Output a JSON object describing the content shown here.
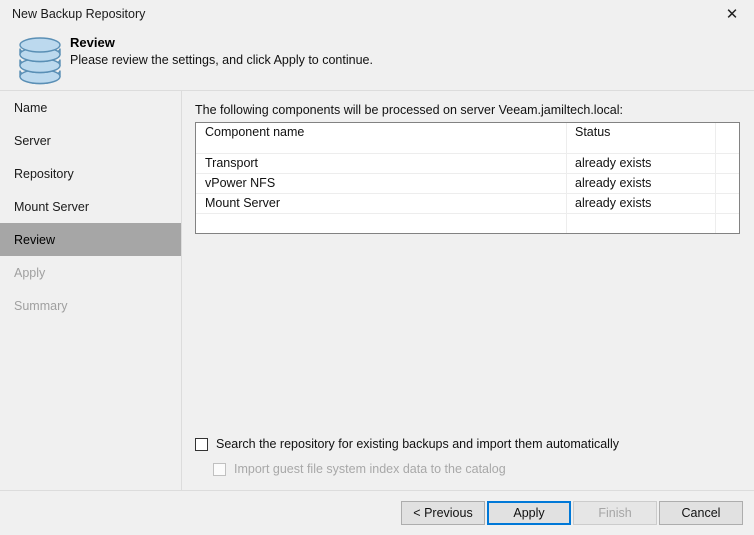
{
  "window": {
    "title": "New Backup Repository",
    "close_icon": "close-icon"
  },
  "header": {
    "icon": "database-repository-icon",
    "title": "Review",
    "subtitle": "Please review the settings, and click Apply to continue."
  },
  "sidebar": {
    "items": [
      {
        "label": "Name",
        "state": "normal"
      },
      {
        "label": "Server",
        "state": "normal"
      },
      {
        "label": "Repository",
        "state": "normal"
      },
      {
        "label": "Mount Server",
        "state": "normal"
      },
      {
        "label": "Review",
        "state": "selected"
      },
      {
        "label": "Apply",
        "state": "disabled"
      },
      {
        "label": "Summary",
        "state": "disabled"
      }
    ],
    "selected_index": 4,
    "highlight_color": "#a6a6a6"
  },
  "main": {
    "components_label": "The following components will be processed on server Veeam.jamiltech.local:",
    "table": {
      "columns": [
        "Component name",
        "Status",
        ""
      ],
      "rows": [
        {
          "component_name": "Transport",
          "status": "already exists"
        },
        {
          "component_name": "vPower NFS",
          "status": "already exists"
        },
        {
          "component_name": "Mount Server",
          "status": "already exists"
        }
      ]
    },
    "options": [
      {
        "label": "Search the repository for existing backups and import them automatically",
        "checked": false,
        "enabled": true
      },
      {
        "label": "Import guest file system index data to the catalog",
        "checked": false,
        "enabled": false
      }
    ]
  },
  "footer": {
    "buttons": [
      {
        "label": "< Previous",
        "state": "normal"
      },
      {
        "label": "Apply",
        "state": "focused"
      },
      {
        "label": "Finish",
        "state": "disabled"
      },
      {
        "label": "Cancel",
        "state": "normal"
      }
    ],
    "focus_color": "#0078d7"
  }
}
